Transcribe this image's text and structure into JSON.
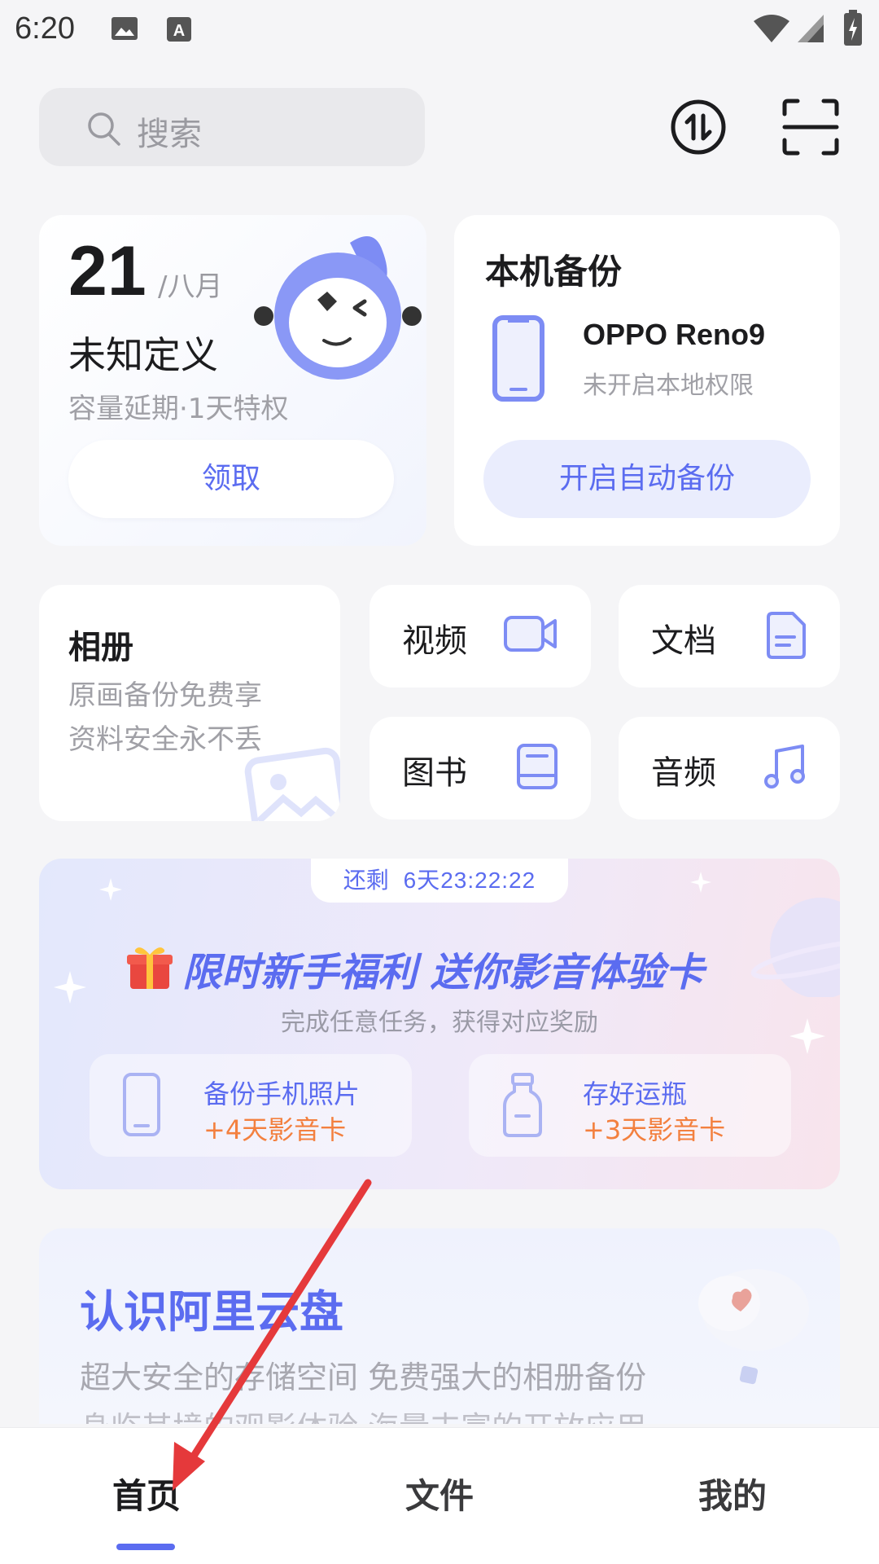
{
  "status_bar": {
    "time": "6:20",
    "icons": [
      "image-icon",
      "keyboard-a-icon",
      "wifi-icon",
      "signal-icon",
      "battery-charging-icon"
    ]
  },
  "header": {
    "search_placeholder": "搜索",
    "transfer_icon": "transfer-updown-icon",
    "scan_icon": "scan-icon"
  },
  "promo_card": {
    "day": "21",
    "month": "/八月",
    "title": "未知定义",
    "subtitle": "容量延期·1天特权",
    "button": "领取"
  },
  "backup_card": {
    "title": "本机备份",
    "device_name": "OPPO Reno9",
    "device_status": "未开启本地权限",
    "button": "开启自动备份"
  },
  "categories": {
    "album": {
      "title": "相册",
      "line1": "原画备份免费享",
      "line2": "资料安全永不丢"
    },
    "video": "视频",
    "document": "文档",
    "book": "图书",
    "audio": "音频"
  },
  "event": {
    "countdown_prefix": "还剩",
    "countdown_time": "6天23:22:22",
    "title": "限时新手福利 送你影音体验卡",
    "subtitle": "完成任意任务，获得对应奖励",
    "tasks": [
      {
        "name": "备份手机照片",
        "reward": "+4天影音卡"
      },
      {
        "name": "存好运瓶",
        "reward": "+3天影音卡"
      }
    ]
  },
  "intro": {
    "title": "认识阿里云盘",
    "line1": "超大安全的存储空间 免费强大的相册备份",
    "line2": "身临其境的观影体验 海量丰富的开放应用"
  },
  "bottom_nav": {
    "items": [
      "首页",
      "文件",
      "我的"
    ],
    "active": "首页"
  },
  "colors": {
    "accent": "#5b6cf0",
    "reward": "#f3803f",
    "annotation_arrow": "#e5393b"
  }
}
